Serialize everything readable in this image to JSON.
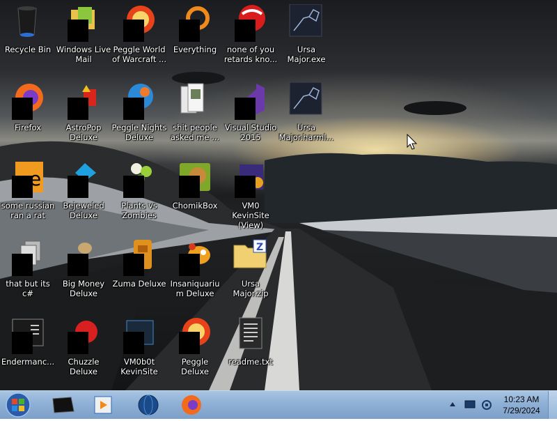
{
  "desktop": {
    "icons": [
      {
        "label": "Recycle Bin",
        "icon": "recycle-bin-icon",
        "redacted": false
      },
      {
        "label": "Windows Live Mail",
        "icon": "windows-live-mail-icon",
        "redacted": true
      },
      {
        "label": "Peggle World of Warcraft ...",
        "icon": "peggle-wow-icon",
        "redacted": true
      },
      {
        "label": "Everything",
        "icon": "everything-search-icon",
        "redacted": true
      },
      {
        "label": "none of you retards kno...",
        "icon": "red-ball-icon",
        "redacted": true
      },
      {
        "label": "Ursa Major.exe",
        "icon": "constellation-icon",
        "redacted": false
      },
      {
        "label": "Firefox",
        "icon": "firefox-icon",
        "redacted": true
      },
      {
        "label": "AstroPop Deluxe",
        "icon": "astropop-icon",
        "redacted": true
      },
      {
        "label": "Peggle Nights Deluxe",
        "icon": "peggle-nights-icon",
        "redacted": true
      },
      {
        "label": "shit people asked me ...",
        "icon": "folder-icon",
        "redacted": false
      },
      {
        "label": "Visual Studio 2015",
        "icon": "visual-studio-icon",
        "redacted": true
      },
      {
        "label": "Ursa Major.harml...",
        "icon": "constellation-icon",
        "redacted": false
      },
      {
        "label": "some russian ran a rat",
        "icon": "document-orange-icon",
        "redacted": true
      },
      {
        "label": "Bejeweled Deluxe",
        "icon": "bejeweled-icon",
        "redacted": true
      },
      {
        "label": "Plants vs Zombies",
        "icon": "plants-vs-zombies-icon",
        "redacted": true
      },
      {
        "label": "ChomikBox",
        "icon": "chomikbox-icon",
        "redacted": true
      },
      {
        "label": "VM0 KevinSite (View)",
        "icon": "vm0-icon",
        "redacted": true
      },
      {
        "label": "that but its c#",
        "icon": "stacked-files-icon",
        "redacted": true
      },
      {
        "label": "Big Money Deluxe",
        "icon": "money-bag-icon",
        "redacted": true
      },
      {
        "label": "Zuma Deluxe",
        "icon": "zuma-icon",
        "redacted": true
      },
      {
        "label": "Insaniquarium Deluxe",
        "icon": "insaniquarium-icon",
        "redacted": true
      },
      {
        "label": "Ursa Major.zip",
        "icon": "zip-folder-icon",
        "redacted": false
      },
      {
        "label": "Endermanc...",
        "icon": "terminal-icon",
        "redacted": true
      },
      {
        "label": "Chuzzle Deluxe",
        "icon": "chuzzle-icon",
        "redacted": true
      },
      {
        "label": "VM0b0t KevinSite",
        "icon": "vm0bot-icon",
        "redacted": true
      },
      {
        "label": "Peggle Deluxe",
        "icon": "peggle-icon",
        "redacted": true
      },
      {
        "label": "readme.txt",
        "icon": "text-file-icon",
        "redacted": false
      }
    ]
  },
  "taskbar": {
    "start": "windows-start-icon",
    "pinned": [
      "cmd-window-icon",
      "media-player-icon",
      "globe-icon",
      "firefox-icon"
    ],
    "tray": [
      "show-hidden-icons-icon",
      "network-icon",
      "volume-icon"
    ],
    "clock": {
      "time": "10:23 AM",
      "date": "7/29/2024"
    }
  },
  "colors": {
    "taskbar": "#8fb0d6",
    "label_text": "#ffffff"
  }
}
